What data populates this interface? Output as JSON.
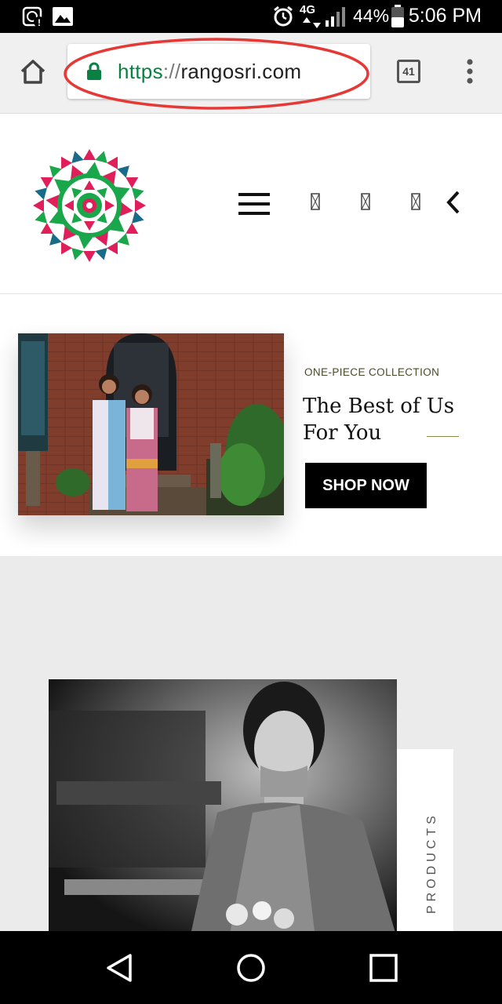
{
  "status_bar": {
    "battery_percent": "44%",
    "time": "5:06 PM",
    "network": "4G",
    "icons": [
      "data-saver-icon",
      "image-icon",
      "alarm-icon",
      "signal-icon",
      "battery-icon"
    ]
  },
  "browser": {
    "url_scheme": "https",
    "url_separator": "://",
    "url_host": "rangosri.com",
    "tab_count": "41",
    "icons": [
      "home-icon",
      "lock-icon",
      "tab-switcher-icon",
      "more-menu-icon"
    ]
  },
  "header": {
    "icons": [
      "mandala-logo",
      "hamburger-menu-icon",
      "search-icon",
      "account-icon",
      "cart-icon",
      "chevron-left-icon"
    ]
  },
  "hero": {
    "eyebrow": "ONE-PIECE COLLECTION",
    "title": "The Best of Us For You",
    "button_label": "SHOP NOW"
  },
  "products": {
    "label": "PRODUCTS"
  },
  "colors": {
    "url_green": "#0b8043",
    "annotation_red": "#e53935",
    "accent_olive": "#8a8a4a"
  }
}
